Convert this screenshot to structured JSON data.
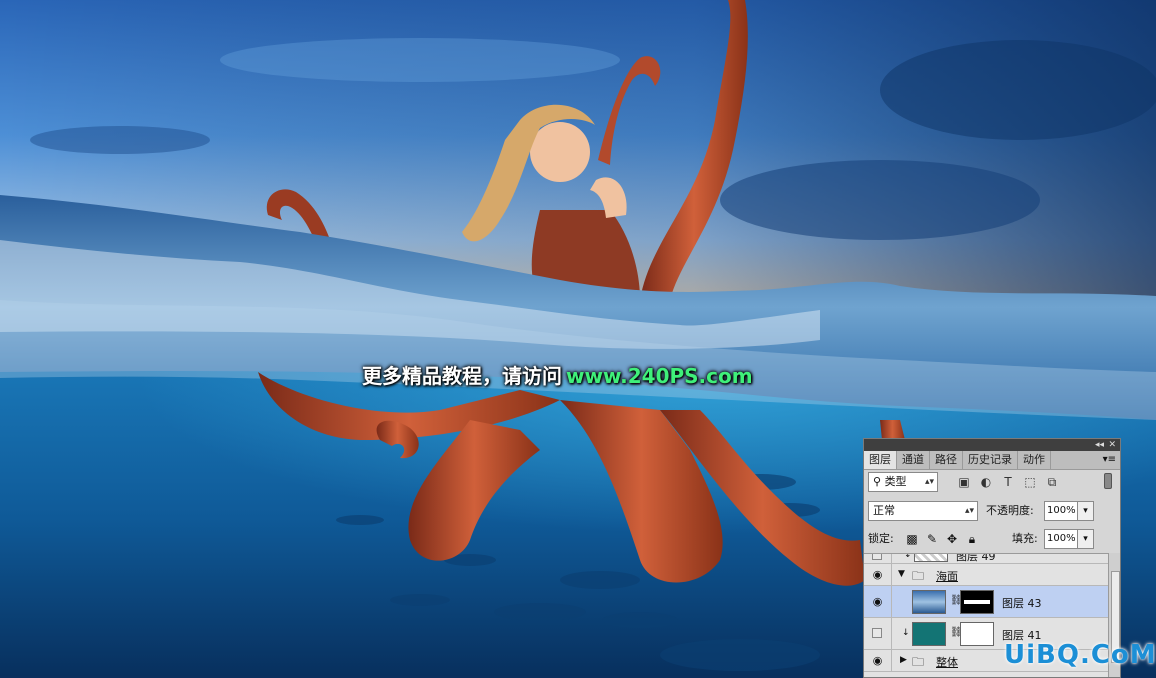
{
  "watermark": {
    "text_cn": "更多精品教程，请访问",
    "url": "www.240PS.com"
  },
  "corner_logo": {
    "text": "UiBQ.CoM"
  },
  "layers_panel": {
    "tabs": [
      {
        "label": "图层",
        "active": true
      },
      {
        "label": "通道",
        "active": false
      },
      {
        "label": "路径",
        "active": false
      },
      {
        "label": "历史记录",
        "active": false
      },
      {
        "label": "动作",
        "active": false
      }
    ],
    "filter_kind": "类型",
    "blend_mode": "正常",
    "opacity_label": "不透明度:",
    "opacity_value": "100%",
    "lock_label": "锁定:",
    "fill_label": "填充:",
    "fill_value": "100%",
    "layers": [
      {
        "name": "图层 49",
        "visible": false
      },
      {
        "name": "海面",
        "visible": true,
        "type": "group",
        "expanded": true
      },
      {
        "name": "图层 43",
        "visible": true,
        "selected": true,
        "mask": true
      },
      {
        "name": "图层 41",
        "visible": false,
        "mask": true,
        "clipped": true
      },
      {
        "name": "整体",
        "visible": true,
        "type": "group",
        "expanded": false
      }
    ]
  },
  "icons": {
    "visibility": "eye-icon",
    "folder": "folder-icon",
    "chain": "link-icon",
    "search": "search-icon"
  }
}
